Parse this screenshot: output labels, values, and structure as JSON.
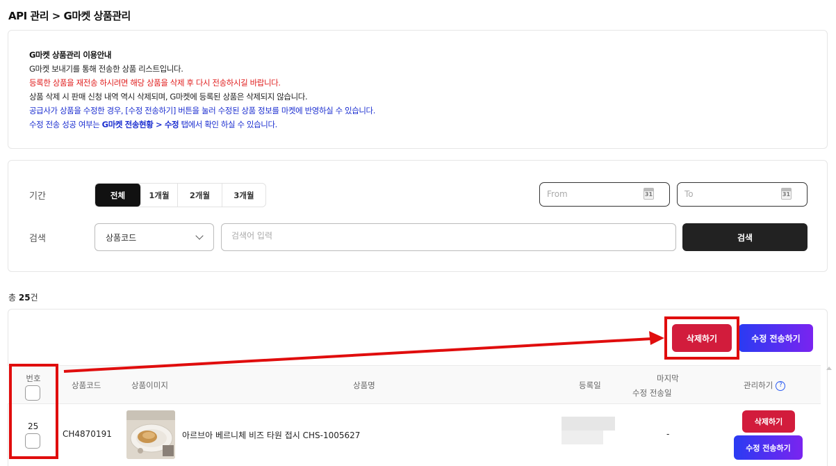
{
  "breadcrumb": "API 관리 > G마켓 상품관리",
  "notice": {
    "heading": "G마켓 상품관리 이용안내",
    "line1": "G마켓 보내기를 통해 전송한 상품 리스트입니다.",
    "line2": "등록한 상품을 재전송 하시려면 해당 상품을 삭제 후 다시 전송하시길 바랍니다.",
    "line3": "상품 삭제 시 판매 신청 내역 역시 삭제되며, G마켓에 등록된 상품은 삭제되지 않습니다.",
    "line4": "공급사가 상품을 수정한 경우, [수정 전송하기] 버튼을 눌러 수정된 상품 정보를 마켓에 반영하실 수 있습니다.",
    "line5_pre": "수정 전송 성공 여부는 ",
    "line5_bold": "G마켓 전송현황 > 수정",
    "line5_post": " 탭에서 확인 하실 수 있습니다."
  },
  "filter": {
    "period_label": "기간",
    "periods": [
      "전체",
      "1개월",
      "2개월",
      "3개월"
    ],
    "active_period": "전체",
    "from_placeholder": "From",
    "to_placeholder": "To",
    "calendar_day": "31",
    "search_label": "검색",
    "search_type": "상품코드",
    "search_placeholder": "검색어 입력",
    "search_button": "검색"
  },
  "summary": {
    "prefix": "총 ",
    "count": "25",
    "suffix": "건"
  },
  "toolbar": {
    "delete_label": "삭제하기",
    "resend_label": "수정 전송하기"
  },
  "table": {
    "columns": {
      "no": "번호",
      "code": "상품코드",
      "image": "상품이미지",
      "name": "상품명",
      "registered": "등록일",
      "last_sent_1": "마지막",
      "last_sent_2": "수정 전송일",
      "manage": "관리하기"
    },
    "rows": [
      {
        "no": "25",
        "code": "CH4870191",
        "name": "아르브아 베르니체 비즈 타원 접시 CHS-1005627",
        "last_sent": "-",
        "delete_label": "삭제하기",
        "resend_label": "수정 전송하기"
      }
    ]
  },
  "colors": {
    "accent_red": "#d21c3c",
    "highlight": "#e00d0d",
    "gradient_start": "#2a3bf2",
    "gradient_end": "#7a24f0"
  }
}
